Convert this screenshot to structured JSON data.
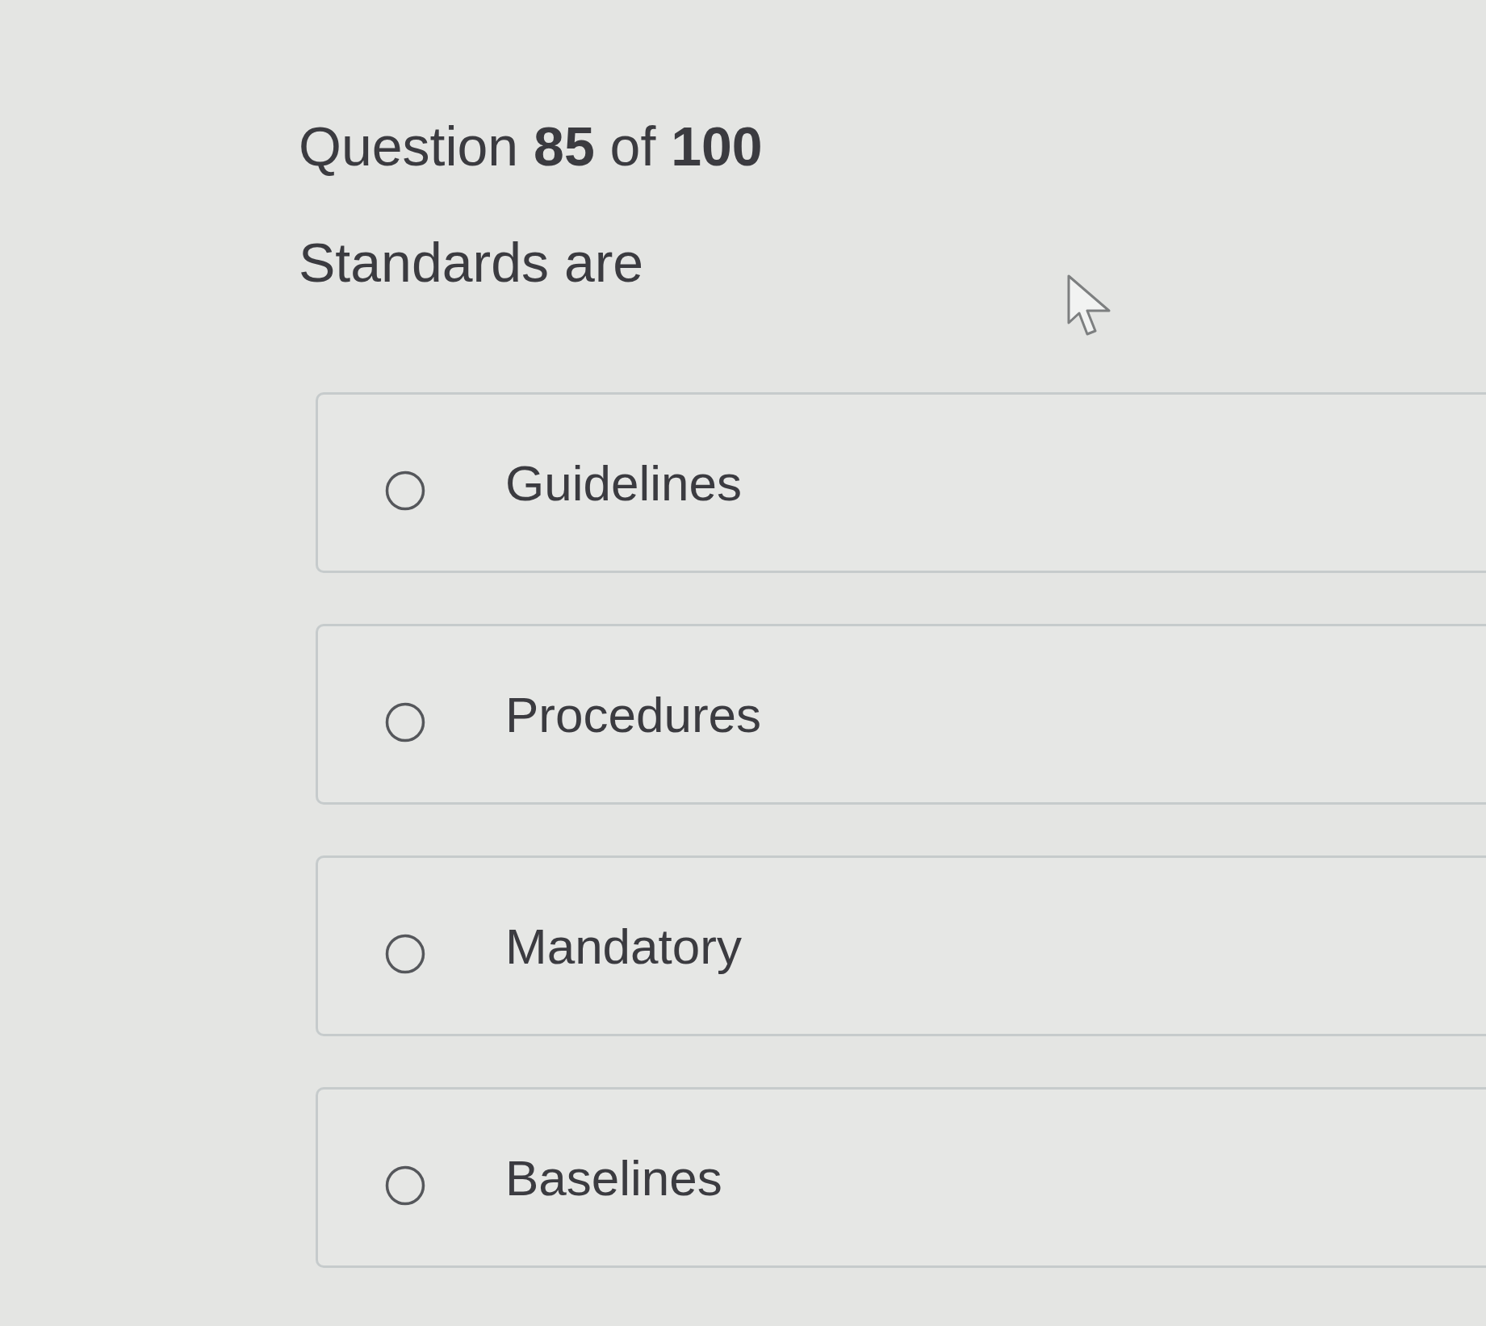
{
  "question": {
    "counter": "Question **85** of **100**",
    "text": "Standards are"
  },
  "options": [
    {
      "label": "Guidelines",
      "selected": false
    },
    {
      "label": "Procedures",
      "selected": false
    },
    {
      "label": "Mandatory",
      "selected": false
    },
    {
      "label": "Baselines",
      "selected": false
    }
  ]
}
